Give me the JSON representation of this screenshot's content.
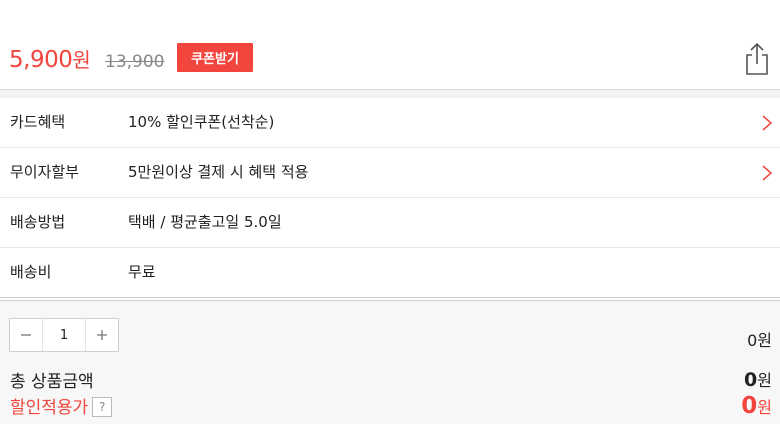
{
  "price": {
    "current_amount": "5,900",
    "current_unit": "원",
    "original": "13,900",
    "coupon_button": "쿠폰받기"
  },
  "info_rows": [
    {
      "label": "카드혜택",
      "value": "10% 할인쿠폰(선착순)",
      "has_arrow": true
    },
    {
      "label": "무이자할부",
      "value": "5만원이상 결제 시 혜택 적용",
      "has_arrow": true
    },
    {
      "label": "배송방법",
      "value": "택배 / 평균출고일 5.0일",
      "has_arrow": false
    },
    {
      "label": "배송비",
      "value": "무료",
      "has_arrow": false
    }
  ],
  "order": {
    "quantity": "1",
    "line_total": "0원",
    "total_label": "총 상품금액",
    "total_amount": "0",
    "total_unit": "원",
    "discount_label": "할인적용가",
    "discount_help": "?",
    "discount_amount": "0",
    "discount_unit": "원"
  },
  "colors": {
    "accent": "#f1453d",
    "divider": "#e6e6e6",
    "panel_bg": "#f7f7f7"
  },
  "icons": {
    "share": "share-icon",
    "chevron": "chevron-right-icon",
    "minus": "minus-icon",
    "plus": "plus-icon"
  }
}
